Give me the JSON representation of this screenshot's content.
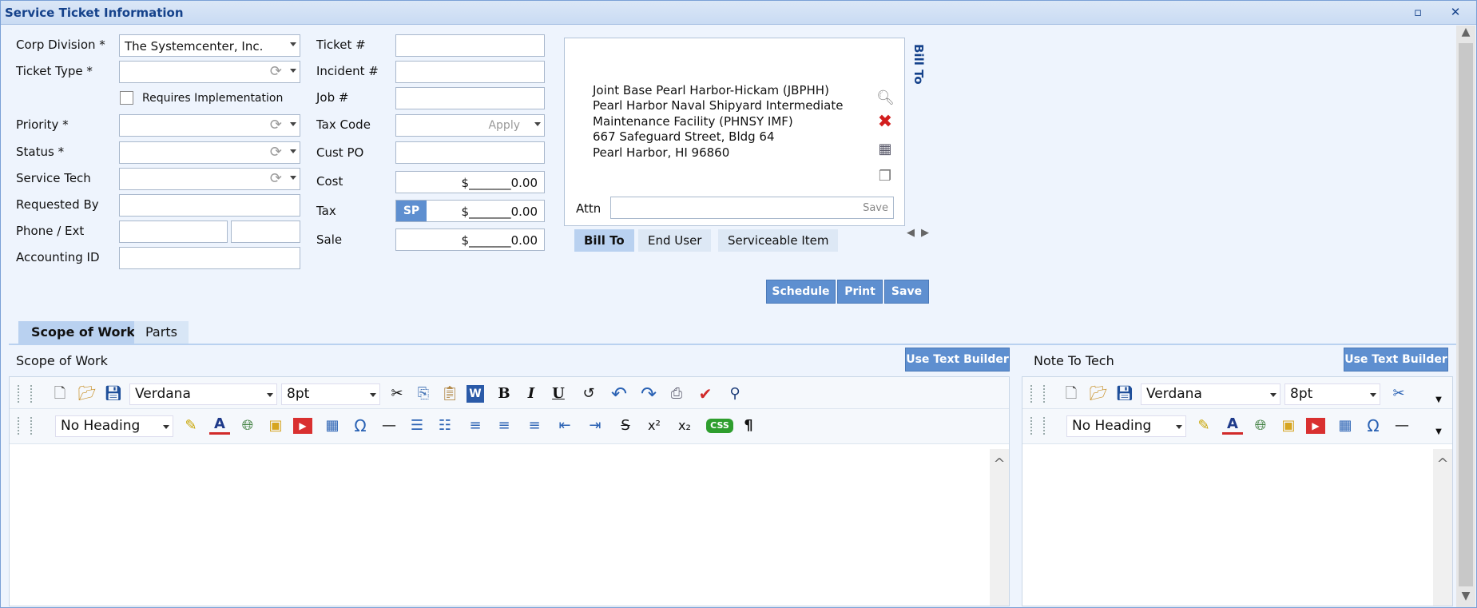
{
  "window": {
    "title": "Service Ticket Information",
    "restore_glyph": "▫",
    "close_glyph": "✕"
  },
  "left_form": {
    "corp_division": {
      "label": "Corp Division *",
      "value": "The Systemcenter, Inc."
    },
    "ticket_type": {
      "label": "Ticket Type *",
      "value": ""
    },
    "requires_impl": {
      "label": "Requires Implementation",
      "checked": false
    },
    "priority": {
      "label": "Priority *",
      "value": ""
    },
    "status": {
      "label": "Status *",
      "value": ""
    },
    "service_tech": {
      "label": "Service Tech",
      "value": ""
    },
    "requested_by": {
      "label": "Requested By",
      "value": ""
    },
    "phone": {
      "label": "Phone / Ext",
      "phone": "",
      "ext": ""
    },
    "accounting_id": {
      "label": "Accounting ID",
      "value": ""
    }
  },
  "mid_form": {
    "ticket_no": {
      "label": "Ticket #",
      "value": ""
    },
    "incident_no": {
      "label": "Incident #",
      "value": ""
    },
    "job_no": {
      "label": "Job #",
      "value": ""
    },
    "tax_code": {
      "label": "Tax Code",
      "placeholder": "Apply"
    },
    "cust_po": {
      "label": "Cust PO",
      "value": ""
    },
    "cost": {
      "label": "Cost",
      "value": "$_______0.00"
    },
    "tax": {
      "label": "Tax",
      "button": "SP",
      "value": "$_______0.00"
    },
    "sale": {
      "label": "Sale",
      "value": "$_______0.00"
    }
  },
  "address_panel": {
    "lines": [
      "Joint Base Pearl Harbor-Hickam (JBPHH)",
      "Pearl Harbor Naval Shipyard  Intermediate",
      "Maintenance Facility (PHNSY  IMF)",
      "667 Safeguard Street, Bldg 64",
      "Pearl Harbor, HI 96860"
    ],
    "attn_label": "Attn",
    "attn_value": "",
    "attn_save": "Save",
    "side_label": "Bill To",
    "tabs": [
      "Bill To",
      "End User",
      "Serviceable Item"
    ],
    "icons": [
      "magnifier-icon",
      "delete-x-icon",
      "building-icon",
      "copy-icon"
    ]
  },
  "actions": {
    "schedule": "Schedule",
    "print": "Print",
    "save": "Save"
  },
  "section_tabs": [
    "Scope of Work",
    "Parts"
  ],
  "scope_editor": {
    "title": "Scope of Work",
    "builder_button": "Use Text Builder",
    "font": "Verdana",
    "size": "8pt",
    "heading": "No Heading"
  },
  "note_editor": {
    "title": "Note To Tech",
    "builder_button": "Use Text Builder",
    "font": "Verdana",
    "size": "8pt",
    "heading": "No Heading"
  },
  "colors": {
    "accent": "#5e8fd0",
    "title": "#15428b",
    "background": "#eef4fd"
  }
}
